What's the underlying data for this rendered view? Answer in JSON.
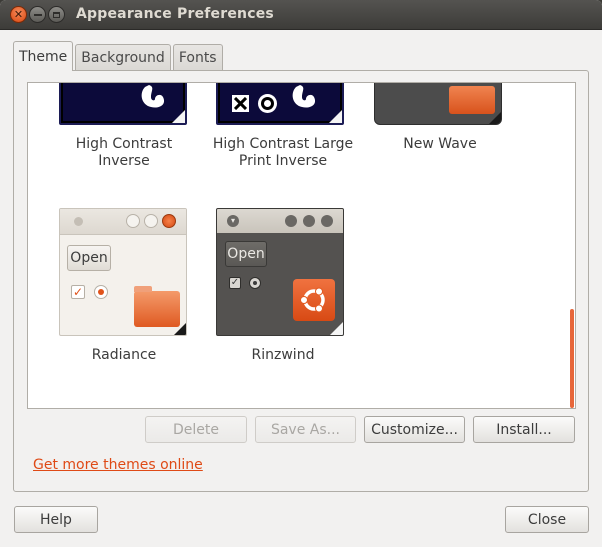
{
  "window": {
    "title": "Appearance Preferences"
  },
  "tabs": [
    {
      "label": "Theme",
      "active": true
    },
    {
      "label": "Background",
      "active": false
    },
    {
      "label": "Fonts",
      "active": false
    }
  ],
  "themes": {
    "row1": [
      {
        "name": "High Contrast Inverse"
      },
      {
        "name": "High Contrast Large Print Inverse"
      },
      {
        "name": "New Wave"
      }
    ],
    "row2": [
      {
        "name": "Radiance",
        "sample_button": "Open"
      },
      {
        "name": "Rinzwind",
        "sample_button": "Open"
      }
    ]
  },
  "actions": {
    "delete": "Delete",
    "save_as": "Save As...",
    "customize": "Customize...",
    "install": "Install..."
  },
  "link": "Get more themes online",
  "footer": {
    "help": "Help",
    "close": "Close"
  },
  "colors": {
    "accent": "#df4a16",
    "scrollbar": "#e7663a",
    "window_bg": "#f2f1f0"
  }
}
